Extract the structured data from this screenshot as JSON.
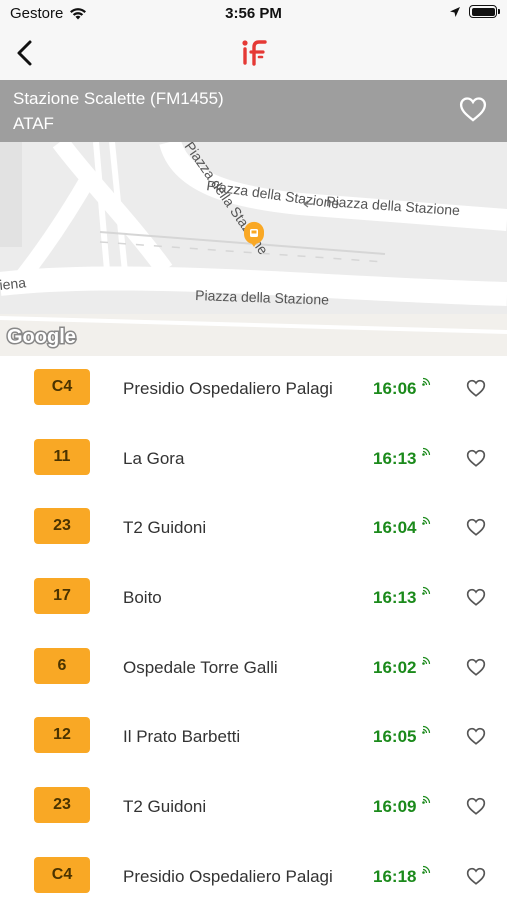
{
  "status_bar": {
    "carrier": "Gestore",
    "time": "3:56 PM"
  },
  "nav": {
    "back_icon": "chevron-left-icon",
    "logo_icon": "if-logo-icon",
    "logo_color": "#e53935"
  },
  "stop": {
    "name": "Stazione Scalette (FM1455)",
    "agency": "ATAF",
    "header_color": "#9e9e9e"
  },
  "map": {
    "street_labels": [
      "Piazza della Stazione",
      "Piazza della Stazione",
      "Piazza della Stazione",
      "iena"
    ],
    "attribution": "Google",
    "marker_icon": "bus-stop-marker-icon",
    "marker_color": "#f9a825"
  },
  "departures": [
    {
      "line": "C4",
      "destination": "Presidio Ospedaliero Palagi",
      "time": "16:06"
    },
    {
      "line": "11",
      "destination": "La Gora",
      "time": "16:13"
    },
    {
      "line": "23",
      "destination": "T2 Guidoni",
      "time": "16:04"
    },
    {
      "line": "17",
      "destination": "Boito",
      "time": "16:13"
    },
    {
      "line": "6",
      "destination": "Ospedale Torre Galli",
      "time": "16:02"
    },
    {
      "line": "12",
      "destination": "Il Prato Barbetti",
      "time": "16:05"
    },
    {
      "line": "23",
      "destination": "T2 Guidoni",
      "time": "16:09"
    },
    {
      "line": "C4",
      "destination": "Presidio Ospedaliero Palagi",
      "time": "16:18"
    }
  ],
  "colors": {
    "line_badge": "#f9a825",
    "time_text": "#1b8a1b"
  }
}
